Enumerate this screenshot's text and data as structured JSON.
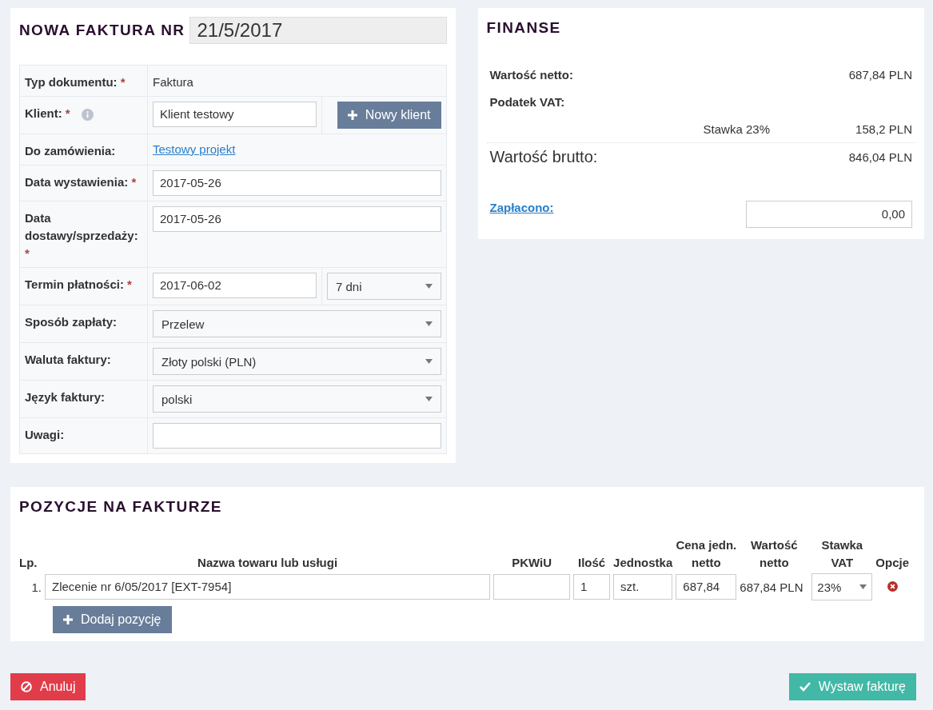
{
  "invoice": {
    "title": "NOWA FAKTURA NR",
    "number": "21/5/2017",
    "fields": [
      {
        "kind": "text",
        "label": "Typ dokumentu:",
        "required_mark": "*",
        "value": "Faktura"
      },
      {
        "kind": "input_button",
        "label": "Klient:",
        "required_mark": "*",
        "info": true,
        "value": "Klient testowy",
        "button": "Nowy klient"
      },
      {
        "kind": "link",
        "label": "Do zamówienia:",
        "value": "Testowy projekt"
      },
      {
        "kind": "input",
        "label": "Data wystawienia:",
        "required_mark": "*",
        "value": "2017-05-26"
      },
      {
        "kind": "input",
        "label": "Data dostawy/sprzedaży:",
        "required_mark": "*",
        "value": "2017-05-26"
      },
      {
        "kind": "input_select",
        "label": "Termin płatności:",
        "required_mark": "*",
        "value": "2017-06-02",
        "option": "7 dni"
      },
      {
        "kind": "select",
        "label": "Sposób zapłaty:",
        "value": "Przelew"
      },
      {
        "kind": "select",
        "label": "Waluta faktury:",
        "value": "Złoty polski (PLN)"
      },
      {
        "kind": "select",
        "label": "Język faktury:",
        "value": "polski"
      },
      {
        "kind": "input",
        "label": "Uwagi:"
      }
    ]
  },
  "finance": {
    "title": "FINANSE",
    "net": {
      "label": "Wartość netto:",
      "value": "687,84 PLN"
    },
    "vat": {
      "label": "Podatek VAT:",
      "rates": [
        {
          "label": "Stawka 23%",
          "value": "158,2 PLN"
        }
      ]
    },
    "gross": {
      "label": "Wartość brutto:",
      "value": "846,04 PLN"
    },
    "paid": {
      "label": "Zapłacono:",
      "value": "0,00"
    }
  },
  "items": {
    "title": "POZYCJE NA FAKTURZE",
    "columns": [
      "Lp.",
      "Nazwa towaru lub usługi",
      "PKWiU",
      "Ilość",
      "Jednostka",
      "Cena jedn. netto",
      "Wartość netto",
      "Stawka VAT",
      "Opcje"
    ],
    "rows": [
      {
        "lp": "1.",
        "name": "Zlecenie nr 6/05/2017 [EXT-7954]",
        "qty": "1",
        "unit": "szt.",
        "price": "687,84",
        "net": "687,84 PLN",
        "vat": "23%"
      }
    ],
    "add_button": "Dodaj pozycję"
  },
  "actions": {
    "cancel": "Anuluj",
    "submit": "Wystaw fakturę"
  }
}
